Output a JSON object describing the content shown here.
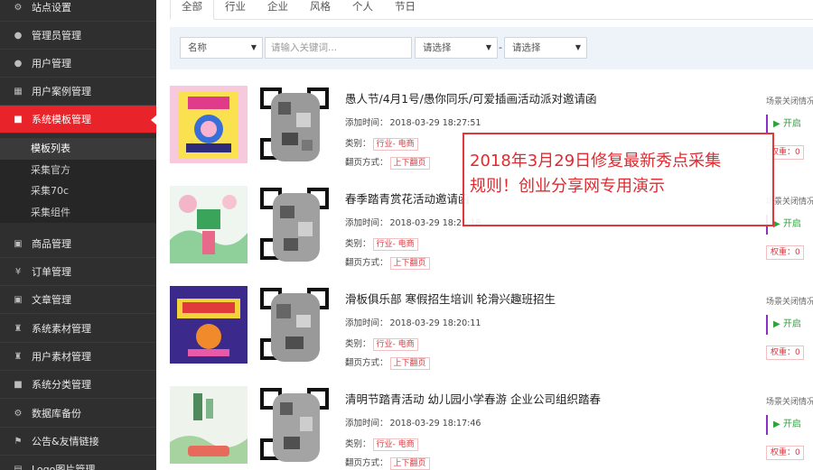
{
  "sidebar": {
    "items": [
      {
        "label": "站点设置",
        "icon": "gears-icon",
        "glyph": "⚙"
      },
      {
        "label": "管理员管理",
        "icon": "user-icon",
        "glyph": "●"
      },
      {
        "label": "用户管理",
        "icon": "user-icon",
        "glyph": "●"
      },
      {
        "label": "用户案例管理",
        "icon": "grid-icon",
        "glyph": "▦"
      },
      {
        "label": "系统模板管理",
        "icon": "briefcase-icon",
        "glyph": "■"
      },
      {
        "label": "商品管理",
        "icon": "box-icon",
        "glyph": "▣"
      },
      {
        "label": "订单管理",
        "icon": "yen-icon",
        "glyph": "¥"
      },
      {
        "label": "文章管理",
        "icon": "box-icon",
        "glyph": "▣"
      },
      {
        "label": "系统素材管理",
        "icon": "gift-icon",
        "glyph": "♜"
      },
      {
        "label": "用户素材管理",
        "icon": "gift-icon",
        "glyph": "♜"
      },
      {
        "label": "系统分类管理",
        "icon": "briefcase-icon",
        "glyph": "■"
      },
      {
        "label": "数据库备份",
        "icon": "gears-icon",
        "glyph": "⚙"
      },
      {
        "label": "公告&友情链接",
        "icon": "bookmark-icon",
        "glyph": "⚑"
      },
      {
        "label": "Logo图片管理",
        "icon": "image-icon",
        "glyph": "▤"
      }
    ],
    "subitems": [
      "模板列表",
      "采集官方",
      "采集70c",
      "采集组件"
    ]
  },
  "tabs": [
    "全部",
    "行业",
    "企业",
    "风格",
    "个人",
    "节日"
  ],
  "filter": {
    "field_select": "名称",
    "keyword_placeholder": "请输入关键词...",
    "select_a": "请选择",
    "dash": "-",
    "select_b": "请选择"
  },
  "labels": {
    "added": "添加时间：",
    "category": "类别：",
    "flip": "翻页方式：",
    "close_info": "场景关闭情况",
    "open": "▶ 开启",
    "weight": "权重：0"
  },
  "templates": [
    {
      "title": "愚人节/4月1号/愚你同乐/可爱插画活动派对邀请函",
      "time": "2018-03-29 18:27:51",
      "category": "行业- 电商",
      "flip": "上下翻页"
    },
    {
      "title": "春季踏青赏花活动邀请函",
      "time": "2018-03-29 18:25:18",
      "category": "行业- 电商",
      "flip": "上下翻页"
    },
    {
      "title": "滑板俱乐部 寒假招生培训 轮滑兴趣班招生",
      "time": "2018-03-29 18:20:11",
      "category": "行业- 电商",
      "flip": "上下翻页"
    },
    {
      "title": "清明节踏青活动 幼儿园小学春游 企业公司组织踏春",
      "time": "2018-03-29 18:17:46",
      "category": "行业- 电商",
      "flip": "上下翻页"
    }
  ],
  "notice": {
    "line1": "2018年3月29日修复最新秀点采集",
    "line2": "规则！创业分享网专用演示"
  },
  "colors": {
    "sidebar_bg": "#2f2f2f",
    "active_red": "#e8242a",
    "filter_bg": "#eef3fa",
    "open_green": "#2ea23c",
    "tag_red": "#d9383f"
  }
}
